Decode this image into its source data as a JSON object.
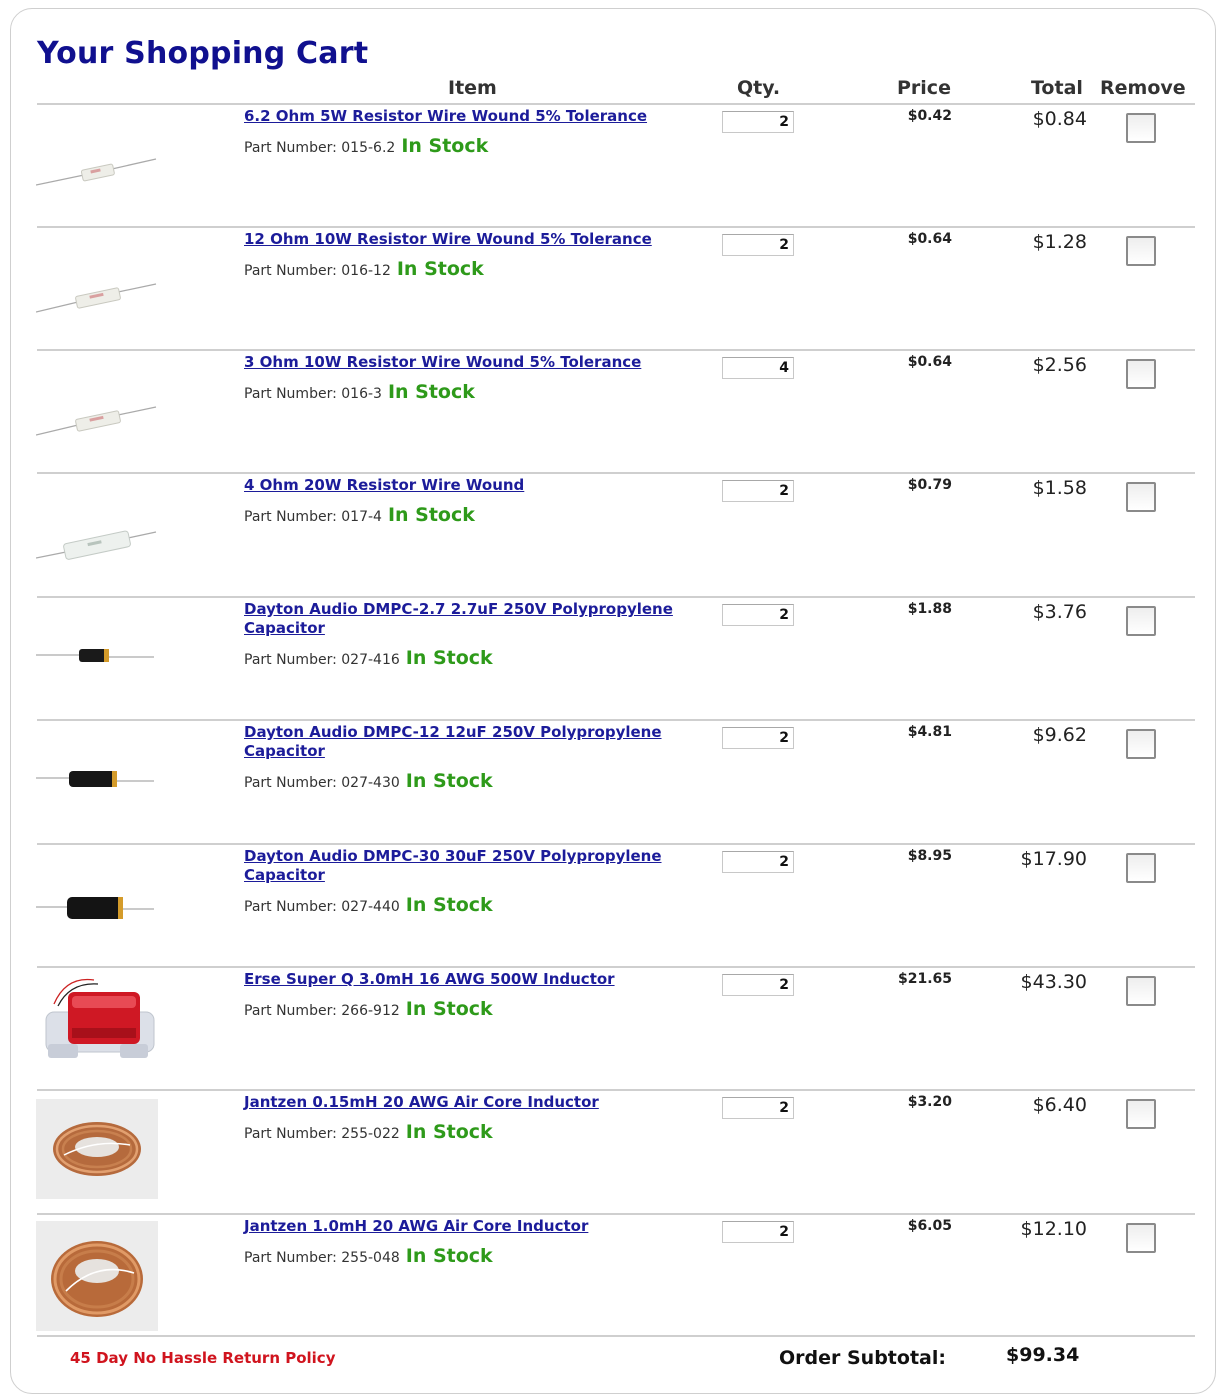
{
  "cart": {
    "title": "Your Shopping Cart",
    "columns": {
      "item": "Item",
      "qty": "Qty.",
      "price": "Price",
      "total": "Total",
      "remove": "Remove"
    },
    "part_label": "Part Number:",
    "items": [
      {
        "name": "6.2 Ohm 5W Resistor Wire Wound 5% Tolerance",
        "part": "015-6.2",
        "stock": "In Stock",
        "qty": "2",
        "price": "$0.42",
        "total": "$0.84",
        "image": "resistor-white-small"
      },
      {
        "name": "12 Ohm 10W Resistor Wire Wound 5% Tolerance",
        "part": "016-12",
        "stock": "In Stock",
        "qty": "2",
        "price": "$0.64",
        "total": "$1.28",
        "image": "resistor-white"
      },
      {
        "name": "3 Ohm 10W Resistor Wire Wound 5% Tolerance",
        "part": "016-3",
        "stock": "In Stock",
        "qty": "4",
        "price": "$0.64",
        "total": "$2.56",
        "image": "resistor-white"
      },
      {
        "name": "4 Ohm 20W Resistor Wire Wound",
        "part": "017-4",
        "stock": "In Stock",
        "qty": "2",
        "price": "$0.79",
        "total": "$1.58",
        "image": "resistor-white-large"
      },
      {
        "name": "Dayton Audio DMPC-2.7 2.7uF 250V Polypropylene Capacitor",
        "part": "027-416",
        "stock": "In Stock",
        "qty": "2",
        "price": "$1.88",
        "total": "$3.76",
        "image": "capacitor-black-small"
      },
      {
        "name": "Dayton Audio DMPC-12 12uF 250V Polypropylene Capacitor",
        "part": "027-430",
        "stock": "In Stock",
        "qty": "2",
        "price": "$4.81",
        "total": "$9.62",
        "image": "capacitor-black"
      },
      {
        "name": "Dayton Audio DMPC-30 30uF 250V Polypropylene Capacitor",
        "part": "027-440",
        "stock": "In Stock",
        "qty": "2",
        "price": "$8.95",
        "total": "$17.90",
        "image": "capacitor-black-large"
      },
      {
        "name": "Erse Super Q 3.0mH 16 AWG 500W Inductor",
        "part": "266-912",
        "stock": "In Stock",
        "qty": "2",
        "price": "$21.65",
        "total": "$43.30",
        "image": "inductor-red"
      },
      {
        "name": "Jantzen 0.15mH 20 AWG Air Core Inductor",
        "part": "255-022",
        "stock": "In Stock",
        "qty": "2",
        "price": "$3.20",
        "total": "$6.40",
        "image": "coil-copper-small"
      },
      {
        "name": "Jantzen 1.0mH 20 AWG Air Core Inductor",
        "part": "255-048",
        "stock": "In Stock",
        "qty": "2",
        "price": "$6.05",
        "total": "$12.10",
        "image": "coil-copper"
      }
    ],
    "footer": {
      "return_policy": "45 Day No Hassle Return Policy",
      "subtotal_label": "Order Subtotal:",
      "subtotal_value": "$99.34"
    },
    "colors": {
      "title": "#10108f",
      "link": "#1c1c9a",
      "stock": "#2e9a1a",
      "policy": "#d0141e"
    }
  }
}
